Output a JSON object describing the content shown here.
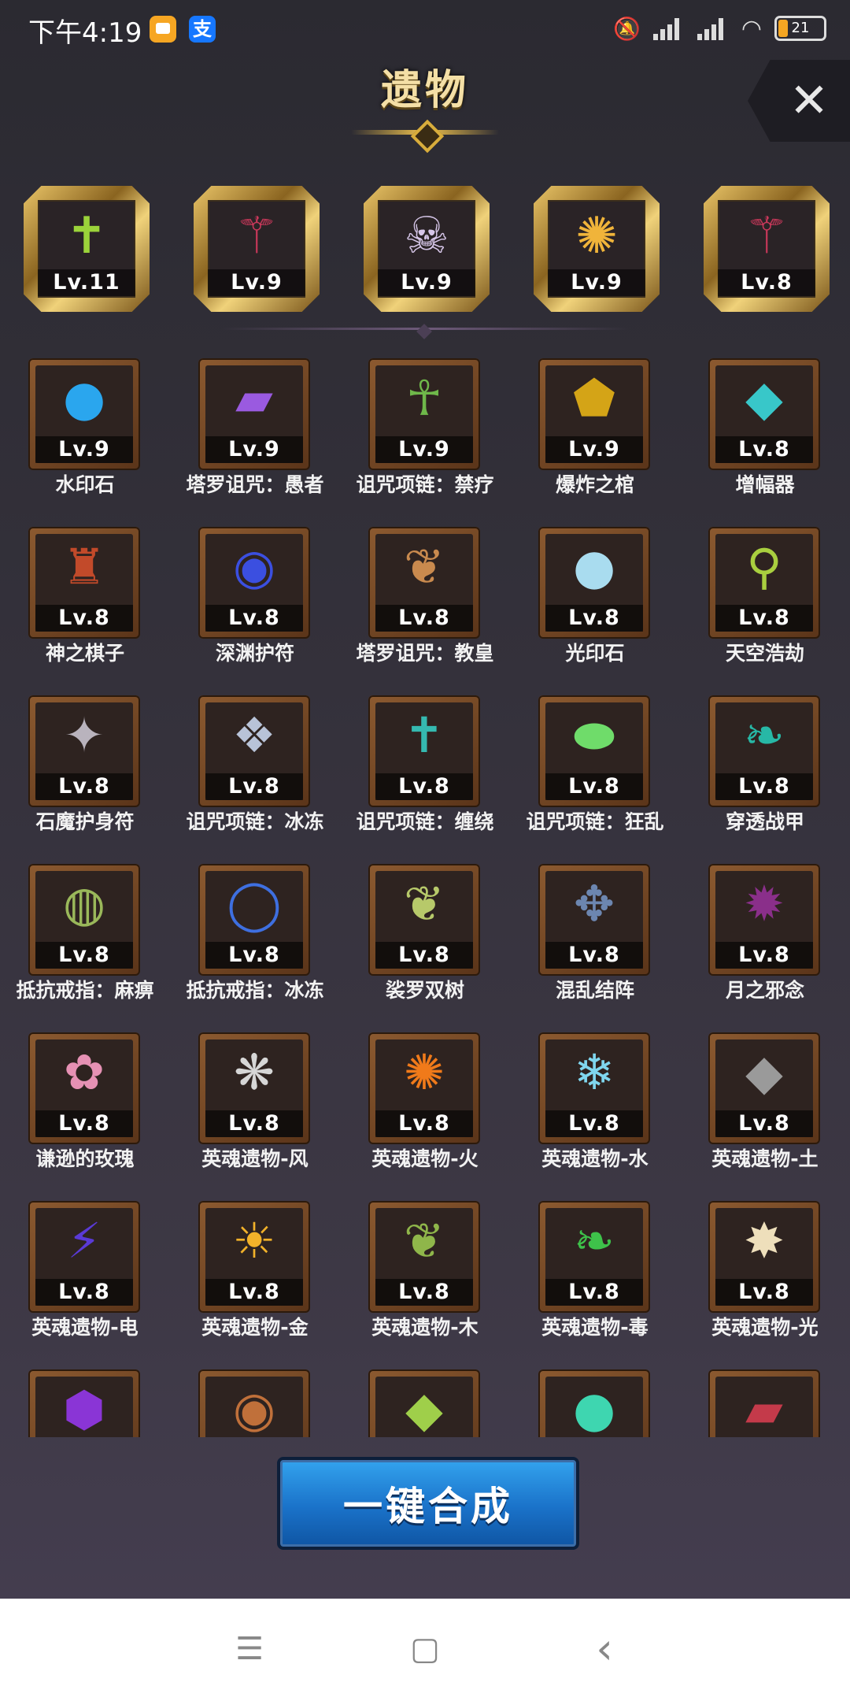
{
  "status_bar": {
    "time": "下午4:19",
    "app2_glyph": "支",
    "battery": "21"
  },
  "header": {
    "title": "遗物",
    "close_glyph": "✕"
  },
  "featured": [
    {
      "level": "Lv.11",
      "icon": "green-cross-icon",
      "glyph": "✝",
      "color": "#9bd33a"
    },
    {
      "level": "Lv.9",
      "icon": "red-claw-icon",
      "glyph": "⚚",
      "color": "#c8385a"
    },
    {
      "level": "Lv.9",
      "icon": "skull-icon",
      "glyph": "☠",
      "color": "#d6c6e8"
    },
    {
      "level": "Lv.9",
      "icon": "gold-amulet-icon",
      "glyph": "✺",
      "color": "#f0b43a"
    },
    {
      "level": "Lv.8",
      "icon": "red-claw-icon",
      "glyph": "⚚",
      "color": "#c8385a"
    }
  ],
  "items": [
    {
      "name": "水印石",
      "level": "Lv.9",
      "icon": "blue-orb-icon",
      "glyph": "●",
      "color": "#2aa6ee"
    },
    {
      "name": "塔罗诅咒：愚者",
      "level": "Lv.9",
      "icon": "purple-card-icon",
      "glyph": "▰",
      "color": "#9a5ae0"
    },
    {
      "name": "诅咒项链：禁疗",
      "level": "Lv.9",
      "icon": "green-necklace-icon",
      "glyph": "☥",
      "color": "#6fb84a"
    },
    {
      "name": "爆炸之棺",
      "level": "Lv.9",
      "icon": "gold-coffin-icon",
      "glyph": "⬟",
      "color": "#d4a417"
    },
    {
      "name": "增幅器",
      "level": "Lv.8",
      "icon": "amplifier-icon",
      "glyph": "◆",
      "color": "#38c7c9"
    },
    {
      "name": "神之棋子",
      "level": "Lv.8",
      "icon": "chess-piece-icon",
      "glyph": "♜",
      "color": "#c24a2a"
    },
    {
      "name": "深渊护符",
      "level": "Lv.8",
      "icon": "abyss-eye-icon",
      "glyph": "◉",
      "color": "#3b4fe0"
    },
    {
      "name": "塔罗诅咒：教皇",
      "level": "Lv.8",
      "icon": "wing-card-icon",
      "glyph": "❦",
      "color": "#c98a4e"
    },
    {
      "name": "光印石",
      "level": "Lv.8",
      "icon": "light-orb-icon",
      "glyph": "●",
      "color": "#a9dcef"
    },
    {
      "name": "天空浩劫",
      "level": "Lv.8",
      "icon": "sky-staff-icon",
      "glyph": "⚲",
      "color": "#a9cf3f"
    },
    {
      "name": "石魔护身符",
      "level": "Lv.8",
      "icon": "gargoyle-talisman-icon",
      "glyph": "✦",
      "color": "#b9b3bd"
    },
    {
      "name": "诅咒项链：冰冻",
      "level": "Lv.8",
      "icon": "frost-necklace-icon",
      "glyph": "❖",
      "color": "#b8c3d8"
    },
    {
      "name": "诅咒项链：缠绕",
      "level": "Lv.8",
      "icon": "teal-necklace-icon",
      "glyph": "✝",
      "color": "#35b9b0"
    },
    {
      "name": "诅咒项链：狂乱",
      "level": "Lv.8",
      "icon": "frenzy-necklace-icon",
      "glyph": "⬬",
      "color": "#6fdc6a"
    },
    {
      "name": "穿透战甲",
      "level": "Lv.8",
      "icon": "armor-icon",
      "glyph": "❧",
      "color": "#27b8a6"
    },
    {
      "name": "抵抗戒指：麻痹",
      "level": "Lv.8",
      "icon": "ring-icon",
      "glyph": "◍",
      "color": "#9ab85a"
    },
    {
      "name": "抵抗戒指：冰冻",
      "level": "Lv.8",
      "icon": "blue-ring-icon",
      "glyph": "◯",
      "color": "#3e6fe0"
    },
    {
      "name": "裟罗双树",
      "level": "Lv.8",
      "icon": "leaf-icon",
      "glyph": "❦",
      "color": "#b7c96a"
    },
    {
      "name": "混乱结阵",
      "level": "Lv.8",
      "icon": "chaos-array-icon",
      "glyph": "✥",
      "color": "#6c86b0"
    },
    {
      "name": "月之邪念",
      "level": "Lv.8",
      "icon": "moon-malice-icon",
      "glyph": "✹",
      "color": "#8a2f8a"
    },
    {
      "name": "谦逊的玫瑰",
      "level": "Lv.8",
      "icon": "rose-icon",
      "glyph": "✿",
      "color": "#e691b4"
    },
    {
      "name": "英魂遗物-风",
      "level": "Lv.8",
      "icon": "wind-feather-icon",
      "glyph": "❋",
      "color": "#d6d6d6"
    },
    {
      "name": "英魂遗物-火",
      "level": "Lv.8",
      "icon": "fire-icon",
      "glyph": "✺",
      "color": "#f07a1a"
    },
    {
      "name": "英魂遗物-水",
      "level": "Lv.8",
      "icon": "water-snowflake-icon",
      "glyph": "❄",
      "color": "#7fd6ee"
    },
    {
      "name": "英魂遗物-土",
      "level": "Lv.8",
      "icon": "earth-rock-icon",
      "glyph": "◆",
      "color": "#9a9a9a"
    },
    {
      "name": "英魂遗物-电",
      "level": "Lv.8",
      "icon": "thunder-icon",
      "glyph": "⚡",
      "color": "#5a3ad6"
    },
    {
      "name": "英魂遗物-金",
      "level": "Lv.8",
      "icon": "metal-sun-icon",
      "glyph": "☀",
      "color": "#f2b22a"
    },
    {
      "name": "英魂遗物-木",
      "level": "Lv.8",
      "icon": "wood-sprout-icon",
      "glyph": "❦",
      "color": "#8fb64a"
    },
    {
      "name": "英魂遗物-毒",
      "level": "Lv.8",
      "icon": "poison-icon",
      "glyph": "❧",
      "color": "#3ec24a"
    },
    {
      "name": "英魂遗物-光",
      "level": "Lv.8",
      "icon": "light-star-icon",
      "glyph": "✸",
      "color": "#eedfbb"
    },
    {
      "name": "",
      "level": "",
      "icon": "purple-crystal-icon",
      "glyph": "⬢",
      "color": "#8a35d6"
    },
    {
      "name": "",
      "level": "",
      "icon": "bronze-disc-icon",
      "glyph": "◉",
      "color": "#c0703a"
    },
    {
      "name": "",
      "level": "",
      "icon": "green-gem-icon",
      "glyph": "◆",
      "color": "#9fcf4a"
    },
    {
      "name": "",
      "level": "",
      "icon": "teal-orb-icon",
      "glyph": "●",
      "color": "#3ed6b0"
    },
    {
      "name": "",
      "level": "",
      "icon": "red-book-icon",
      "glyph": "▰",
      "color": "#c43a4a"
    }
  ],
  "merge_button": {
    "label": "一键合成"
  },
  "nav": {
    "menu_glyph": "☰",
    "home_glyph": "▢",
    "back_glyph": "‹"
  }
}
